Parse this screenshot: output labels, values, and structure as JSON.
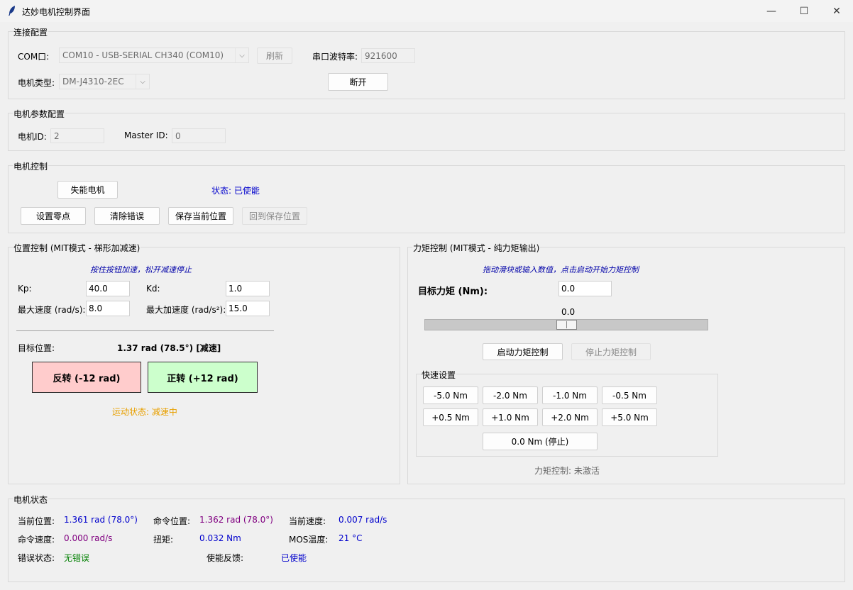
{
  "window": {
    "title": "达妙电机控制界面",
    "controls": [
      "—",
      "☐",
      "✕"
    ]
  },
  "connection": {
    "legend": "连接配置",
    "com_label": "COM口:",
    "com_value": "COM10 - USB-SERIAL CH340 (COM10)",
    "refresh": "刷新",
    "baud_label": "串口波特率:",
    "baud_value": "921600",
    "motor_type_label": "电机类型:",
    "motor_type_value": "DM-J4310-2EC",
    "disconnect": "断开"
  },
  "params": {
    "legend": "电机参数配置",
    "id_label": "电机ID:",
    "id_value": "2",
    "master_label": "Master ID:",
    "master_value": "0"
  },
  "control": {
    "legend": "电机控制",
    "disable": "失能电机",
    "status": "状态: 已使能",
    "set_zero": "设置零点",
    "clear_error": "清除错误",
    "save_pos": "保存当前位置",
    "goto_saved": "回到保存位置"
  },
  "position": {
    "legend": "位置控制 (MIT模式 - 梯形加减速)",
    "hint": "按住按钮加速，松开减速停止",
    "kp_label": "Kp:",
    "kp_value": "40.0",
    "kd_label": "Kd:",
    "kd_value": "1.0",
    "vmax_label": "最大速度 (rad/s):",
    "vmax_value": "8.0",
    "amax_label": "最大加速度 (rad/s²):",
    "amax_value": "15.0",
    "target_label": "目标位置:",
    "target_value": "1.37 rad (78.5°) [减速]",
    "reverse": "反转 (-12 rad)",
    "forward": "正转 (+12 rad)",
    "motion_status": "运动状态: 减速中",
    "reverse_color": "#ffcccc",
    "forward_color": "#ccffcc",
    "motion_color": "#e8a000"
  },
  "torque": {
    "legend": "力矩控制 (MIT模式 - 纯力矩输出)",
    "hint": "拖动滑块或输入数值，点击启动开始力矩控制",
    "target_label": "目标力矩 (Nm):",
    "target_value": "0.0",
    "slider_value": "0.0",
    "start": "启动力矩控制",
    "stop": "停止力矩控制",
    "quick_legend": "快速设置",
    "quick_row1": [
      "-5.0 Nm",
      "-2.0 Nm",
      "-1.0 Nm",
      "-0.5 Nm"
    ],
    "quick_row2": [
      "+0.5 Nm",
      "+1.0 Nm",
      "+2.0 Nm",
      "+5.0 Nm"
    ],
    "zero": "0.0 Nm (停止)",
    "status": "力矩控制: 未激活"
  },
  "motor_status": {
    "legend": "电机状态",
    "cur_pos_label": "当前位置:",
    "cur_pos_value": "1.361 rad (78.0°)",
    "cmd_pos_label": "命令位置:",
    "cmd_pos_value": "1.362 rad (78.0°)",
    "cur_vel_label": "当前速度:",
    "cur_vel_value": "0.007 rad/s",
    "cmd_vel_label": "命令速度:",
    "cmd_vel_value": "0.000 rad/s",
    "torque_label": "扭矩:",
    "torque_value": "0.032 Nm",
    "mos_label": "MOS温度:",
    "mos_value": "21 °C",
    "err_label": "错误状态:",
    "err_value": "无错误",
    "enable_label": "使能反馈:",
    "enable_value": "已使能",
    "colors": {
      "blue": "#0000cc",
      "purple": "#800080",
      "green": "#008000"
    }
  }
}
